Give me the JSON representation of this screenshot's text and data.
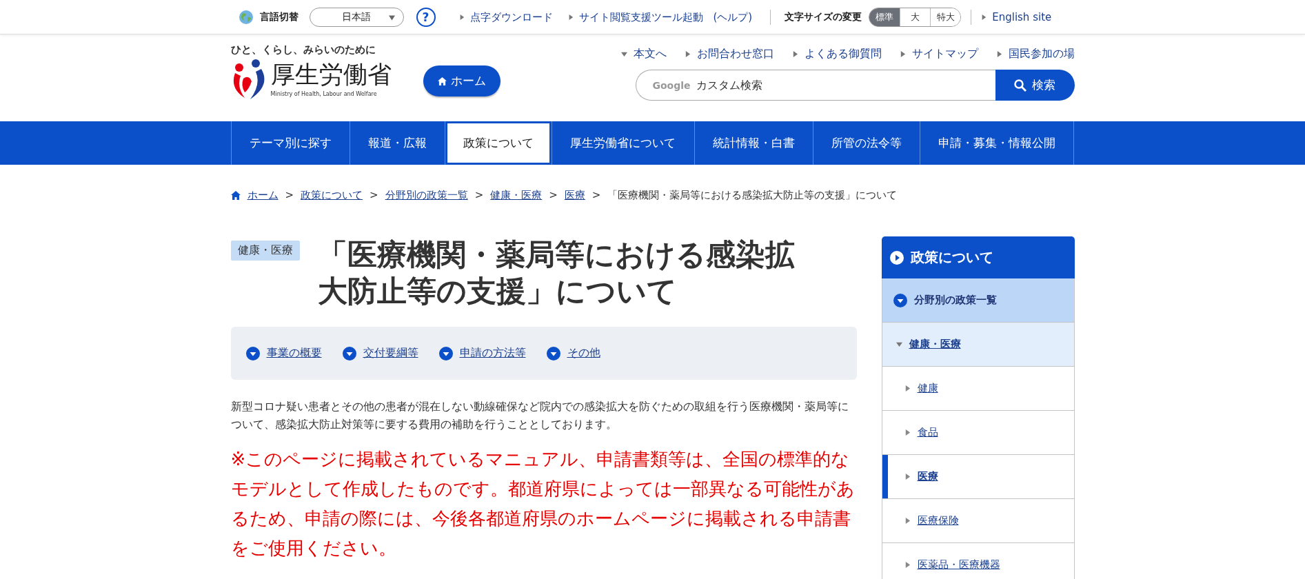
{
  "top_bar": {
    "language_label": "言語切替",
    "language_select": "日本語",
    "help": "?",
    "links": [
      "点字ダウンロード",
      "サイト閲覧支援ツール起動　(ヘルプ)"
    ],
    "font_size_label": "文字サイズの変更",
    "font_sizes": [
      {
        "label": "標準",
        "selected": true
      },
      {
        "label": "大",
        "selected": false
      },
      {
        "label": "特大",
        "selected": false
      }
    ],
    "english_link": "English site"
  },
  "header": {
    "tagline": "ひと、くらし、みらいのために",
    "logo_text": "厚生労働省",
    "logo_subtext": "Ministry of Health, Labour and Welfare",
    "home_button": "ホーム",
    "links": [
      {
        "label": "本文へ",
        "kind": "anchor"
      },
      {
        "label": "お問合わせ窓口",
        "kind": "link"
      },
      {
        "label": "よくある御質問",
        "kind": "link"
      },
      {
        "label": "サイトマップ",
        "kind": "link"
      },
      {
        "label": "国民参加の場",
        "kind": "link"
      }
    ],
    "search": {
      "brand": "Google",
      "placeholder": "カスタム検索",
      "button": "検索"
    }
  },
  "nav": [
    {
      "label": "テーマ別に探す",
      "selected": false
    },
    {
      "label": "報道・広報",
      "selected": false
    },
    {
      "label": "政策について",
      "selected": true
    },
    {
      "label": "厚生労働省について",
      "selected": false
    },
    {
      "label": "統計情報・白書",
      "selected": false
    },
    {
      "label": "所管の法令等",
      "selected": false
    },
    {
      "label": "申請・募集・情報公開",
      "selected": false
    }
  ],
  "breadcrumb": {
    "links": [
      "ホーム",
      "政策について",
      "分野別の政策一覧",
      "健康・医療",
      "医療"
    ],
    "separator": ">",
    "current": "「医療機関・薬局等における感染拡大防止等の支援」について"
  },
  "tag": "健康・医療",
  "title": "「医療機関・薬局等における感染拡大防止等の支援」について",
  "anchors": [
    "事業の概要",
    "交付要綱等",
    "申請の方法等",
    "その他"
  ],
  "description": "新型コロナ疑い患者とその他の患者が混在しない動線確保など院内での感染拡大を防ぐための取組を行う医療機関・薬局等について、感染拡大防止対策等に要する費用の補助を行うこととしております。",
  "notice": "※このページに掲載されているマニュアル、申請書類等は、全国の標準的なモデルとして作成したものです。都道府県によっては一部異なる可能性があるため、申請の際には、今後各都道府県のホームページに掲載される申請書をご使用ください。",
  "sidebar": {
    "title": "政策について",
    "items": [
      {
        "label": "分野別の政策一覧",
        "expanded": true,
        "children": [
          {
            "label": "健康・医療",
            "expanded": true,
            "children": [
              {
                "label": "健康",
                "selected": false
              },
              {
                "label": "食品",
                "selected": false
              },
              {
                "label": "医療",
                "selected": true
              },
              {
                "label": "医療保険",
                "selected": false
              },
              {
                "label": "医薬品・医療機器",
                "selected": false
              }
            ]
          }
        ]
      }
    ]
  }
}
